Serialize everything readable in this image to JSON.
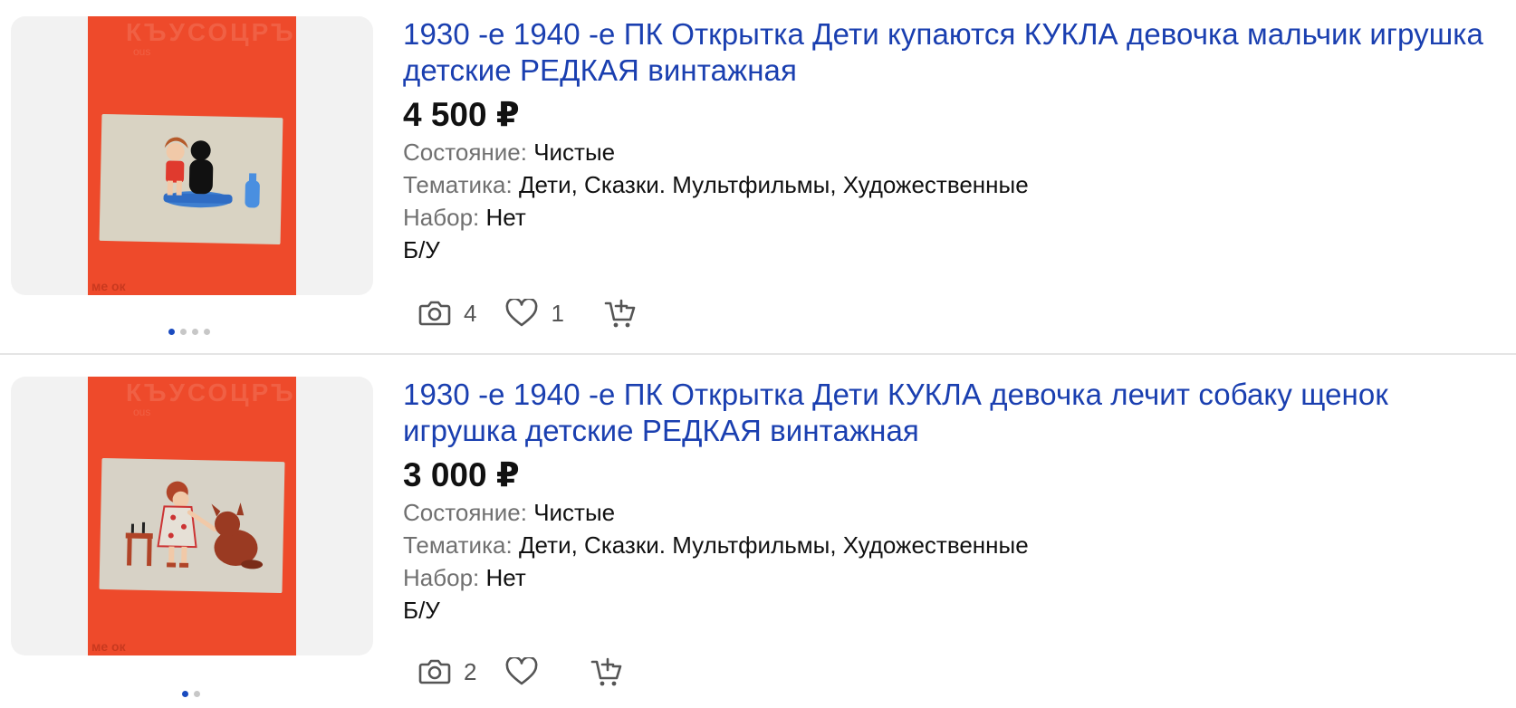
{
  "listings": [
    {
      "title": "1930 -е 1940 -е ПК Открытка Дети купаются КУКЛА девочка мальчик игрушка детские РЕДКАЯ винтажная",
      "price": "4 500 ₽",
      "attributes": [
        {
          "key": "Состояние:",
          "value": "Чистые"
        },
        {
          "key": "Тематика:",
          "value": "Дети, Сказки. Мультфильмы, Художественные"
        },
        {
          "key": "Набор:",
          "value": "Нет"
        }
      ],
      "condition": "Б/У",
      "photos_count": "4",
      "likes_count": "1",
      "photo_dots": 4,
      "active_dot": 0,
      "photo_text_top": "КЪУСОЦРЪ",
      "photo_text_sub": "ous",
      "photo_text_bottom": "ме ок",
      "icons": {
        "camera": "camera-icon",
        "heart": "heart-icon",
        "cart": "add-to-cart-icon"
      }
    },
    {
      "title": "1930 -е 1940 -е ПК Открытка Дети КУКЛА девочка лечит собаку щенок игрушка детские РЕДКАЯ винтажная",
      "price": "3 000 ₽",
      "attributes": [
        {
          "key": "Состояние:",
          "value": "Чистые"
        },
        {
          "key": "Тематика:",
          "value": "Дети, Сказки. Мультфильмы, Художественные"
        },
        {
          "key": "Набор:",
          "value": "Нет"
        }
      ],
      "condition": "Б/У",
      "photos_count": "2",
      "likes_count": "",
      "photo_dots": 2,
      "active_dot": 0,
      "photo_text_top": "КЪУСОЦРЪ",
      "photo_text_sub": "ous",
      "photo_text_bottom": "ме ок",
      "icons": {
        "camera": "camera-icon",
        "heart": "heart-icon",
        "cart": "add-to-cart-icon"
      }
    }
  ],
  "colors": {
    "link": "#1a3fb0",
    "photo_bg": "#ee4a2b",
    "dot_active": "#1a4bbf"
  }
}
